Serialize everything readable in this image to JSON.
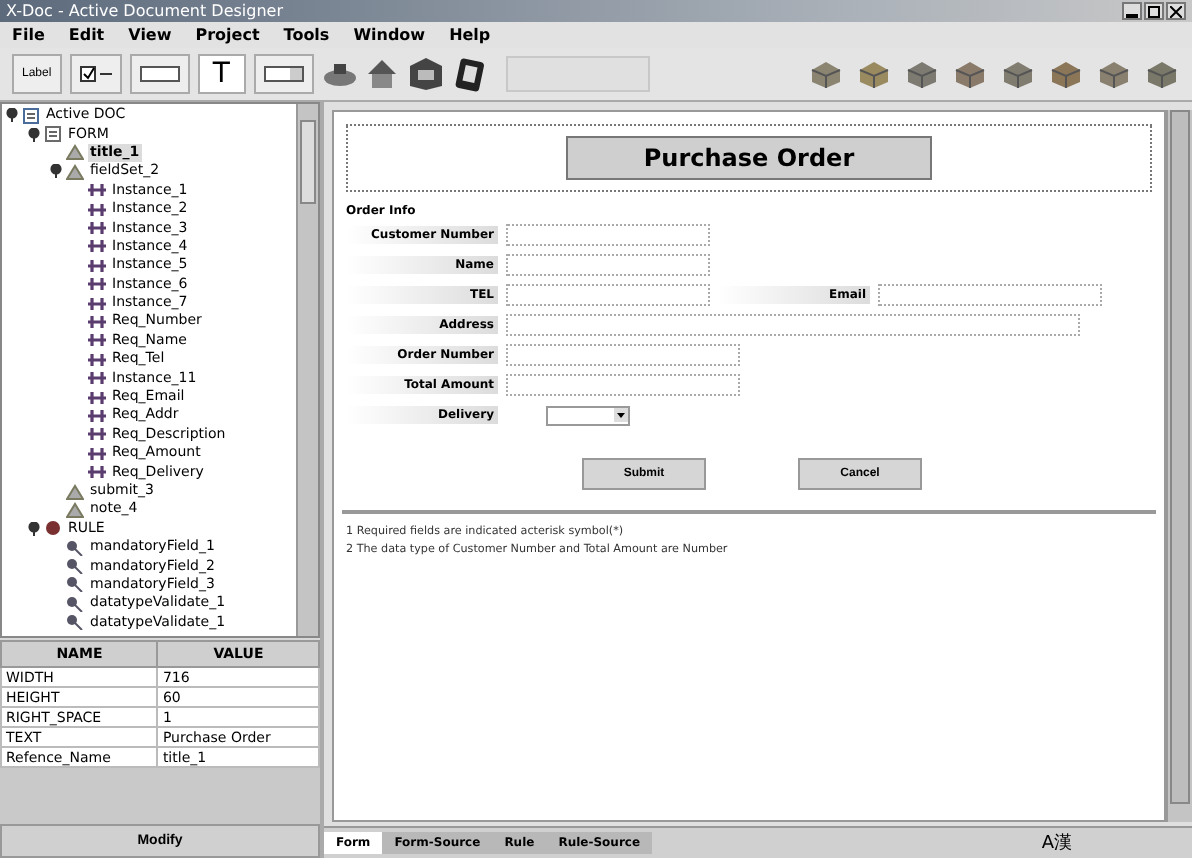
{
  "window": {
    "title": "X-Doc - Active Document Designer"
  },
  "menu": [
    "File",
    "Edit",
    "View",
    "Project",
    "Tools",
    "Window",
    "Help"
  ],
  "toolbar": {
    "label_tool": "Label",
    "text_tool": "T"
  },
  "tree": [
    {
      "label": "Active DOC",
      "kind": "doc",
      "expanded": true,
      "selected": false,
      "children": [
        {
          "label": "FORM",
          "kind": "form",
          "expanded": true,
          "selected": false,
          "children": [
            {
              "label": "title_1",
              "kind": "item",
              "selected": true
            },
            {
              "label": "fieldSet_2",
              "kind": "item",
              "expanded": true,
              "selected": false,
              "children": [
                {
                  "label": "Instance_1",
                  "kind": "field",
                  "selected": false
                },
                {
                  "label": "Instance_2",
                  "kind": "field",
                  "selected": false
                },
                {
                  "label": "Instance_3",
                  "kind": "field",
                  "selected": false
                },
                {
                  "label": "Instance_4",
                  "kind": "field",
                  "selected": false
                },
                {
                  "label": "Instance_5",
                  "kind": "field",
                  "selected": false
                },
                {
                  "label": "Instance_6",
                  "kind": "field",
                  "selected": false
                },
                {
                  "label": "Instance_7",
                  "kind": "field",
                  "selected": false
                },
                {
                  "label": "Req_Number",
                  "kind": "field",
                  "selected": false
                },
                {
                  "label": "Req_Name",
                  "kind": "field",
                  "selected": false
                },
                {
                  "label": "Req_Tel",
                  "kind": "field",
                  "selected": false
                },
                {
                  "label": "Instance_11",
                  "kind": "field",
                  "selected": false
                },
                {
                  "label": "Req_Email",
                  "kind": "field",
                  "selected": false
                },
                {
                  "label": "Req_Addr",
                  "kind": "field",
                  "selected": false
                },
                {
                  "label": "Req_Description",
                  "kind": "field",
                  "selected": false
                },
                {
                  "label": "Req_Amount",
                  "kind": "field",
                  "selected": false
                },
                {
                  "label": "Req_Delivery",
                  "kind": "field",
                  "selected": false
                }
              ]
            },
            {
              "label": "submit_3",
              "kind": "item",
              "selected": false
            },
            {
              "label": "note_4",
              "kind": "item",
              "selected": false
            }
          ]
        },
        {
          "label": "RULE",
          "kind": "rule",
          "expanded": true,
          "selected": false,
          "children": [
            {
              "label": "mandatoryField_1",
              "kind": "check",
              "selected": false
            },
            {
              "label": "mandatoryField_2",
              "kind": "check",
              "selected": false
            },
            {
              "label": "mandatoryField_3",
              "kind": "check",
              "selected": false
            },
            {
              "label": "datatypeValidate_1",
              "kind": "check",
              "selected": false
            },
            {
              "label": "datatypeValidate_1",
              "kind": "check",
              "selected": false
            }
          ]
        }
      ]
    }
  ],
  "properties": {
    "columns": [
      "NAME",
      "VALUE"
    ],
    "rows": [
      [
        "WIDTH",
        "716"
      ],
      [
        "HEIGHT",
        "60"
      ],
      [
        "RIGHT_SPACE",
        "1"
      ],
      [
        "TEXT",
        "Purchase Order"
      ],
      [
        "Refence_Name",
        "title_1"
      ]
    ]
  },
  "modify_button": "Modify",
  "form": {
    "title": "Purchase Order",
    "section": "Order Info",
    "rows": [
      [
        {
          "label": "Customer Number",
          "kind": "text"
        }
      ],
      [
        {
          "label": "Name",
          "kind": "text"
        }
      ],
      [
        {
          "label": "TEL",
          "kind": "text"
        },
        {
          "label": "Email",
          "kind": "text"
        }
      ],
      [
        {
          "label": "Address",
          "kind": "text"
        }
      ],
      [
        {
          "label": "Order Number",
          "kind": "text"
        }
      ],
      [
        {
          "label": "Total Amount",
          "kind": "text"
        }
      ],
      [
        {
          "label": "Delivery",
          "kind": "select"
        }
      ]
    ],
    "buttons": [
      "Submit",
      "Cancel"
    ],
    "notes": [
      "1 Required fields are indicated acterisk symbol(*)",
      "2 The data type of Customer Number and Total Amount are Number"
    ]
  },
  "tabs": [
    {
      "label": "Form",
      "selected": true
    },
    {
      "label": "Form-Source",
      "selected": false
    },
    {
      "label": "Rule",
      "selected": false
    },
    {
      "label": "Rule-Source",
      "selected": false
    }
  ],
  "ime": "A漢"
}
